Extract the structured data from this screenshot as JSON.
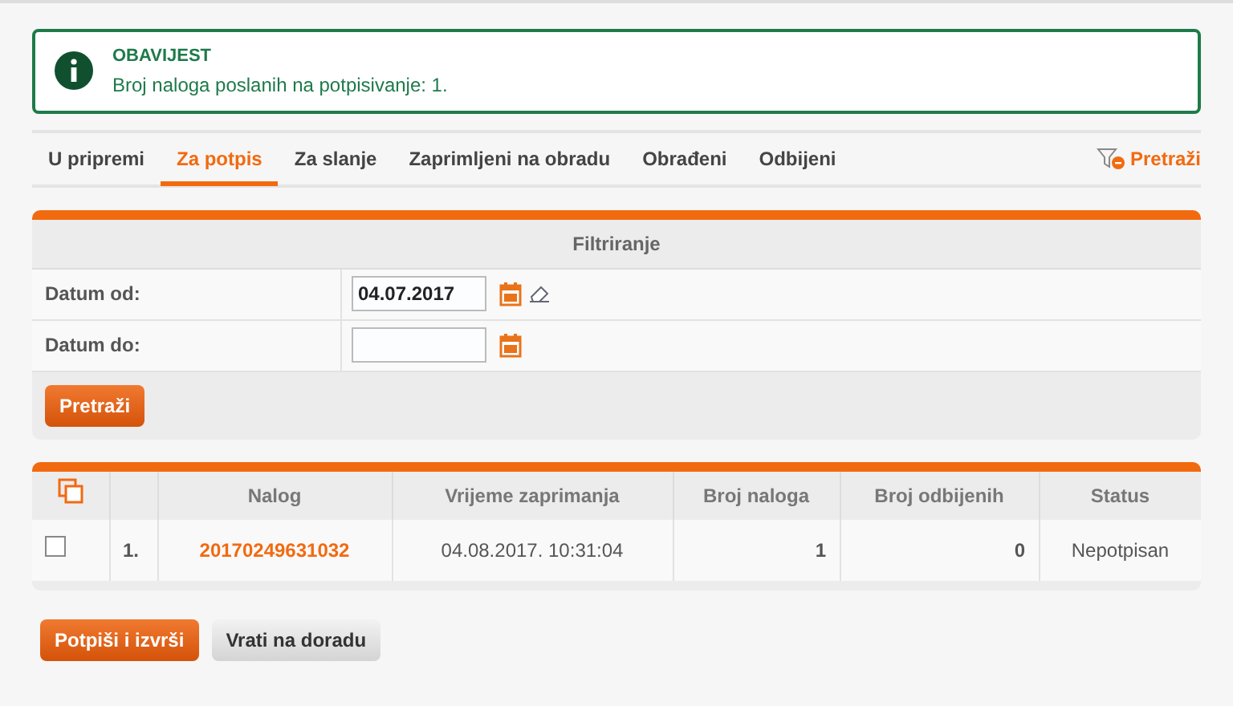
{
  "notice": {
    "title": "OBAVIJEST",
    "message": "Broj naloga poslanih na potpisivanje: 1."
  },
  "tabs": [
    {
      "label": "U pripremi",
      "selected": false
    },
    {
      "label": "Za potpis",
      "selected": true
    },
    {
      "label": "Za slanje",
      "selected": false
    },
    {
      "label": "Zaprimljeni na obradu",
      "selected": false
    },
    {
      "label": "Obrađeni",
      "selected": false
    },
    {
      "label": "Odbijeni",
      "selected": false
    }
  ],
  "search_toggle": "Pretraži",
  "filter": {
    "title": "Filtriranje",
    "fields": [
      {
        "label": "Datum od:",
        "value": "04.07.2017",
        "clearable": true
      },
      {
        "label": "Datum do:",
        "clearable": false
      }
    ],
    "button": "Pretraži"
  },
  "table": {
    "columns": [
      "Nalog",
      "Vrijeme zaprimanja",
      "Broj naloga",
      "Broj odbijenih",
      "Status"
    ],
    "rows": [
      {
        "checked": false,
        "number": "1.",
        "nalog": "20170249631032",
        "time": "04.08.2017. 10:31:04",
        "count": "1",
        "rejected": "0",
        "status": "Nepotpisan"
      }
    ]
  },
  "actions": [
    {
      "label": "Potpiši i izvrši",
      "kind": "primary"
    },
    {
      "label": "Vrati na doradu",
      "kind": "secondary"
    }
  ]
}
